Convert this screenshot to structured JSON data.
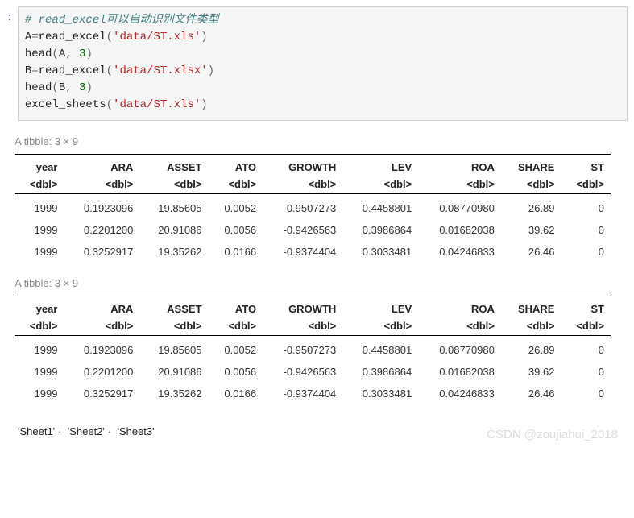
{
  "prompt": ":",
  "code": {
    "comment": "# read_excel可以自动识别文件类型",
    "l1_a": "A",
    "l1_eq": "=",
    "l1_fn": "read_excel",
    "l1_open": "(",
    "l1_str": "'data/ST.xls'",
    "l1_close": ")",
    "l2_fn": "head",
    "l2_open": "(",
    "l2_arg1": "A",
    "l2_comma": ", ",
    "l2_num": "3",
    "l2_close": ")",
    "l3_a": "B",
    "l3_eq": "=",
    "l3_fn": "read_excel",
    "l3_open": "(",
    "l3_str": "'data/ST.xlsx'",
    "l3_close": ")",
    "l4_fn": "head",
    "l4_open": "(",
    "l4_arg1": "B",
    "l4_comma": ", ",
    "l4_num": "3",
    "l4_close": ")",
    "l5_fn": "excel_sheets",
    "l5_open": "(",
    "l5_str": "'data/ST.xls'",
    "l5_close": ")"
  },
  "tibble_caption": "A tibble: 3 × 9",
  "columns": [
    "year",
    "ARA",
    "ASSET",
    "ATO",
    "GROWTH",
    "LEV",
    "ROA",
    "SHARE",
    "ST"
  ],
  "type_label": "<dbl>",
  "table1": {
    "rows": [
      [
        "1999",
        "0.1923096",
        "19.85605",
        "0.0052",
        "-0.9507273",
        "0.4458801",
        "0.08770980",
        "26.89",
        "0"
      ],
      [
        "1999",
        "0.2201200",
        "20.91086",
        "0.0056",
        "-0.9426563",
        "0.3986864",
        "0.01682038",
        "39.62",
        "0"
      ],
      [
        "1999",
        "0.3252917",
        "19.35262",
        "0.0166",
        "-0.9374404",
        "0.3033481",
        "0.04246833",
        "26.46",
        "0"
      ]
    ]
  },
  "table2": {
    "rows": [
      [
        "1999",
        "0.1923096",
        "19.85605",
        "0.0052",
        "-0.9507273",
        "0.4458801",
        "0.08770980",
        "26.89",
        "0"
      ],
      [
        "1999",
        "0.2201200",
        "20.91086",
        "0.0056",
        "-0.9426563",
        "0.3986864",
        "0.01682038",
        "39.62",
        "0"
      ],
      [
        "1999",
        "0.3252917",
        "19.35262",
        "0.0166",
        "-0.9374404",
        "0.3033481",
        "0.04246833",
        "26.46",
        "0"
      ]
    ]
  },
  "sheets": [
    "'Sheet1'",
    "'Sheet2'",
    "'Sheet3'"
  ],
  "sheet_sep": "·",
  "watermark": "CSDN @zoujiahui_2018"
}
